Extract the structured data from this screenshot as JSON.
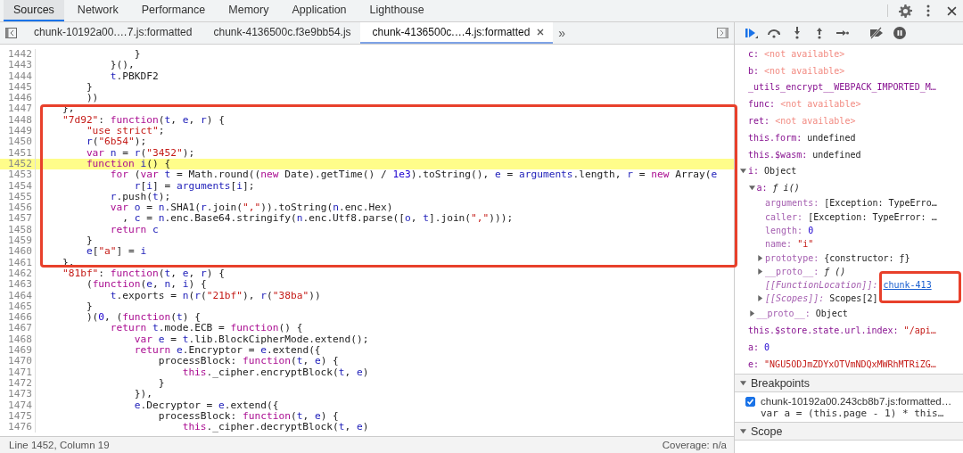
{
  "panel_tabs": [
    {
      "label": "Sources",
      "selected": true
    },
    {
      "label": "Network",
      "selected": false
    },
    {
      "label": "Performance",
      "selected": false
    },
    {
      "label": "Memory",
      "selected": false
    },
    {
      "label": "Application",
      "selected": false
    },
    {
      "label": "Lighthouse",
      "selected": false
    }
  ],
  "file_tabs": [
    {
      "label": "chunk-10192a00.…7.js:formatted",
      "selected": false
    },
    {
      "label": "chunk-4136500c.f3e9bb54.js",
      "selected": false
    },
    {
      "label": "chunk-4136500c.…4.js:formatted",
      "selected": true
    }
  ],
  "more_tabs": "»",
  "editor": {
    "lines": [
      {
        "number": "1442",
        "current": false,
        "code": [
          {
            "kind": "plain",
            "text": "                }"
          }
        ]
      },
      {
        "number": "1443",
        "current": false,
        "code": [
          {
            "kind": "plain",
            "text": "            }(),"
          }
        ]
      },
      {
        "number": "1444",
        "current": false,
        "code": [
          {
            "kind": "var",
            "text": "            t"
          },
          {
            "kind": "plain",
            "text": ".PBKDF2"
          }
        ]
      },
      {
        "number": "1445",
        "current": false,
        "code": [
          {
            "kind": "plain",
            "text": "        }"
          }
        ]
      },
      {
        "number": "1446",
        "current": false,
        "code": [
          {
            "kind": "plain",
            "text": "        ))"
          }
        ]
      },
      {
        "number": "1447",
        "current": false,
        "code": [
          {
            "kind": "plain",
            "text": "    },"
          }
        ]
      },
      {
        "number": "1448",
        "current": false,
        "code": [
          {
            "kind": "str",
            "text": "    \"7d92\""
          },
          {
            "kind": "plain",
            "text": ": "
          },
          {
            "kind": "kw",
            "text": "function"
          },
          {
            "kind": "plain",
            "text": "("
          },
          {
            "kind": "var",
            "text": "t"
          },
          {
            "kind": "plain",
            "text": ", "
          },
          {
            "kind": "var",
            "text": "e"
          },
          {
            "kind": "plain",
            "text": ", "
          },
          {
            "kind": "var",
            "text": "r"
          },
          {
            "kind": "plain",
            "text": ") {"
          }
        ]
      },
      {
        "number": "1449",
        "current": false,
        "code": [
          {
            "kind": "str",
            "text": "        \"use strict\""
          },
          {
            "kind": "plain",
            "text": ";"
          }
        ]
      },
      {
        "number": "1450",
        "current": false,
        "code": [
          {
            "kind": "var",
            "text": "        r"
          },
          {
            "kind": "plain",
            "text": "("
          },
          {
            "kind": "str",
            "text": "\"6b54\""
          },
          {
            "kind": "plain",
            "text": ");"
          }
        ]
      },
      {
        "number": "1451",
        "current": false,
        "code": [
          {
            "kind": "kw",
            "text": "        var"
          },
          {
            "kind": "var",
            "text": " n"
          },
          {
            "kind": "plain",
            "text": " = "
          },
          {
            "kind": "var",
            "text": "r"
          },
          {
            "kind": "plain",
            "text": "("
          },
          {
            "kind": "str",
            "text": "\"3452\""
          },
          {
            "kind": "plain",
            "text": ");"
          }
        ]
      },
      {
        "number": "1452",
        "current": true,
        "code": [
          {
            "kind": "kw",
            "text": "        function"
          },
          {
            "kind": "var",
            "text": " i"
          },
          {
            "kind": "plain",
            "text": "() {"
          }
        ]
      },
      {
        "number": "1453",
        "current": false,
        "code": [
          {
            "kind": "kw",
            "text": "            for"
          },
          {
            "kind": "plain",
            "text": " ("
          },
          {
            "kind": "kw",
            "text": "var"
          },
          {
            "kind": "var",
            "text": " t"
          },
          {
            "kind": "plain",
            "text": " = Math.round(("
          },
          {
            "kind": "kw",
            "text": "new"
          },
          {
            "kind": "plain",
            "text": " Date).getTime() / "
          },
          {
            "kind": "num",
            "text": "1e3"
          },
          {
            "kind": "plain",
            "text": ").toString(), "
          },
          {
            "kind": "var",
            "text": "e"
          },
          {
            "kind": "plain",
            "text": " = "
          },
          {
            "kind": "var",
            "text": "arguments"
          },
          {
            "kind": "plain",
            "text": ".length, "
          },
          {
            "kind": "var",
            "text": "r"
          },
          {
            "kind": "plain",
            "text": " = "
          },
          {
            "kind": "kw",
            "text": "new"
          },
          {
            "kind": "plain",
            "text": " Array("
          },
          {
            "kind": "var",
            "text": "e"
          }
        ]
      },
      {
        "number": "1454",
        "current": false,
        "code": [
          {
            "kind": "var",
            "text": "                r"
          },
          {
            "kind": "plain",
            "text": "["
          },
          {
            "kind": "var",
            "text": "i"
          },
          {
            "kind": "plain",
            "text": "] = "
          },
          {
            "kind": "var",
            "text": "arguments"
          },
          {
            "kind": "plain",
            "text": "["
          },
          {
            "kind": "var",
            "text": "i"
          },
          {
            "kind": "plain",
            "text": "];"
          }
        ]
      },
      {
        "number": "1455",
        "current": false,
        "code": [
          {
            "kind": "var",
            "text": "            r"
          },
          {
            "kind": "plain",
            "text": ".push("
          },
          {
            "kind": "var",
            "text": "t"
          },
          {
            "kind": "plain",
            "text": ");"
          }
        ]
      },
      {
        "number": "1456",
        "current": false,
        "code": [
          {
            "kind": "kw",
            "text": "            var"
          },
          {
            "kind": "var",
            "text": " o"
          },
          {
            "kind": "plain",
            "text": " = "
          },
          {
            "kind": "var",
            "text": "n"
          },
          {
            "kind": "plain",
            "text": ".SHA1("
          },
          {
            "kind": "var",
            "text": "r"
          },
          {
            "kind": "plain",
            "text": ".join("
          },
          {
            "kind": "str",
            "text": "\",\""
          },
          {
            "kind": "plain",
            "text": ")).toString("
          },
          {
            "kind": "var",
            "text": "n"
          },
          {
            "kind": "plain",
            "text": ".enc.Hex)"
          }
        ]
      },
      {
        "number": "1457",
        "current": false,
        "code": [
          {
            "kind": "plain",
            "text": "              , "
          },
          {
            "kind": "var",
            "text": "c"
          },
          {
            "kind": "plain",
            "text": " = "
          },
          {
            "kind": "var",
            "text": "n"
          },
          {
            "kind": "plain",
            "text": ".enc.Base64.stringify("
          },
          {
            "kind": "var",
            "text": "n"
          },
          {
            "kind": "plain",
            "text": ".enc.Utf8.parse(["
          },
          {
            "kind": "var",
            "text": "o"
          },
          {
            "kind": "plain",
            "text": ", "
          },
          {
            "kind": "var",
            "text": "t"
          },
          {
            "kind": "plain",
            "text": "].join("
          },
          {
            "kind": "str",
            "text": "\",\""
          },
          {
            "kind": "plain",
            "text": ")));"
          }
        ]
      },
      {
        "number": "1458",
        "current": false,
        "code": [
          {
            "kind": "kw",
            "text": "            return"
          },
          {
            "kind": "var",
            "text": " c"
          }
        ]
      },
      {
        "number": "1459",
        "current": false,
        "code": [
          {
            "kind": "plain",
            "text": "        }"
          }
        ]
      },
      {
        "number": "1460",
        "current": false,
        "code": [
          {
            "kind": "var",
            "text": "        e"
          },
          {
            "kind": "plain",
            "text": "["
          },
          {
            "kind": "str",
            "text": "\"a\""
          },
          {
            "kind": "plain",
            "text": "] = "
          },
          {
            "kind": "var",
            "text": "i"
          }
        ]
      },
      {
        "number": "1461",
        "current": false,
        "code": [
          {
            "kind": "plain",
            "text": "    },"
          }
        ]
      },
      {
        "number": "1462",
        "current": false,
        "code": [
          {
            "kind": "str",
            "text": "    \"81bf\""
          },
          {
            "kind": "plain",
            "text": ": "
          },
          {
            "kind": "kw",
            "text": "function"
          },
          {
            "kind": "plain",
            "text": "("
          },
          {
            "kind": "var",
            "text": "t"
          },
          {
            "kind": "plain",
            "text": ", "
          },
          {
            "kind": "var",
            "text": "e"
          },
          {
            "kind": "plain",
            "text": ", "
          },
          {
            "kind": "var",
            "text": "r"
          },
          {
            "kind": "plain",
            "text": ") {"
          }
        ]
      },
      {
        "number": "1463",
        "current": false,
        "code": [
          {
            "kind": "plain",
            "text": "        ("
          },
          {
            "kind": "kw",
            "text": "function"
          },
          {
            "kind": "plain",
            "text": "("
          },
          {
            "kind": "var",
            "text": "e"
          },
          {
            "kind": "plain",
            "text": ", "
          },
          {
            "kind": "var",
            "text": "n"
          },
          {
            "kind": "plain",
            "text": ", "
          },
          {
            "kind": "var",
            "text": "i"
          },
          {
            "kind": "plain",
            "text": ") {"
          }
        ]
      },
      {
        "number": "1464",
        "current": false,
        "code": [
          {
            "kind": "var",
            "text": "            t"
          },
          {
            "kind": "plain",
            "text": ".exports = "
          },
          {
            "kind": "var",
            "text": "n"
          },
          {
            "kind": "plain",
            "text": "("
          },
          {
            "kind": "var",
            "text": "r"
          },
          {
            "kind": "plain",
            "text": "("
          },
          {
            "kind": "str",
            "text": "\"21bf\""
          },
          {
            "kind": "plain",
            "text": "), "
          },
          {
            "kind": "var",
            "text": "r"
          },
          {
            "kind": "plain",
            "text": "("
          },
          {
            "kind": "str",
            "text": "\"38ba\""
          },
          {
            "kind": "plain",
            "text": "))"
          }
        ]
      },
      {
        "number": "1465",
        "current": false,
        "code": [
          {
            "kind": "plain",
            "text": "        }"
          }
        ]
      },
      {
        "number": "1466",
        "current": false,
        "code": [
          {
            "kind": "plain",
            "text": "        )("
          },
          {
            "kind": "num",
            "text": "0"
          },
          {
            "kind": "plain",
            "text": ", ("
          },
          {
            "kind": "kw",
            "text": "function"
          },
          {
            "kind": "plain",
            "text": "("
          },
          {
            "kind": "var",
            "text": "t"
          },
          {
            "kind": "plain",
            "text": ") {"
          }
        ]
      },
      {
        "number": "1467",
        "current": false,
        "code": [
          {
            "kind": "kw",
            "text": "            return"
          },
          {
            "kind": "var",
            "text": " t"
          },
          {
            "kind": "plain",
            "text": ".mode.ECB = "
          },
          {
            "kind": "kw",
            "text": "function"
          },
          {
            "kind": "plain",
            "text": "() {"
          }
        ]
      },
      {
        "number": "1468",
        "current": false,
        "code": [
          {
            "kind": "kw",
            "text": "                var"
          },
          {
            "kind": "var",
            "text": " e"
          },
          {
            "kind": "plain",
            "text": " = "
          },
          {
            "kind": "var",
            "text": "t"
          },
          {
            "kind": "plain",
            "text": ".lib.BlockCipherMode.extend();"
          }
        ]
      },
      {
        "number": "1469",
        "current": false,
        "code": [
          {
            "kind": "kw",
            "text": "                return"
          },
          {
            "kind": "var",
            "text": " e"
          },
          {
            "kind": "plain",
            "text": ".Encryptor = "
          },
          {
            "kind": "var",
            "text": "e"
          },
          {
            "kind": "plain",
            "text": ".extend({"
          }
        ]
      },
      {
        "number": "1470",
        "current": false,
        "code": [
          {
            "kind": "plain",
            "text": "                    processBlock: "
          },
          {
            "kind": "kw",
            "text": "function"
          },
          {
            "kind": "plain",
            "text": "("
          },
          {
            "kind": "var",
            "text": "t"
          },
          {
            "kind": "plain",
            "text": ", "
          },
          {
            "kind": "var",
            "text": "e"
          },
          {
            "kind": "plain",
            "text": ") {"
          }
        ]
      },
      {
        "number": "1471",
        "current": false,
        "code": [
          {
            "kind": "kw",
            "text": "                        this"
          },
          {
            "kind": "plain",
            "text": "._cipher.encryptBlock("
          },
          {
            "kind": "var",
            "text": "t"
          },
          {
            "kind": "plain",
            "text": ", "
          },
          {
            "kind": "var",
            "text": "e"
          },
          {
            "kind": "plain",
            "text": ")"
          }
        ]
      },
      {
        "number": "1472",
        "current": false,
        "code": [
          {
            "kind": "plain",
            "text": "                    }"
          }
        ]
      },
      {
        "number": "1473",
        "current": false,
        "code": [
          {
            "kind": "plain",
            "text": "                }),"
          }
        ]
      },
      {
        "number": "1474",
        "current": false,
        "code": [
          {
            "kind": "var",
            "text": "                e"
          },
          {
            "kind": "plain",
            "text": ".Decryptor = "
          },
          {
            "kind": "var",
            "text": "e"
          },
          {
            "kind": "plain",
            "text": ".extend({"
          }
        ]
      },
      {
        "number": "1475",
        "current": false,
        "code": [
          {
            "kind": "plain",
            "text": "                    processBlock: "
          },
          {
            "kind": "kw",
            "text": "function"
          },
          {
            "kind": "plain",
            "text": "("
          },
          {
            "kind": "var",
            "text": "t"
          },
          {
            "kind": "plain",
            "text": ", "
          },
          {
            "kind": "var",
            "text": "e"
          },
          {
            "kind": "plain",
            "text": ") {"
          }
        ]
      },
      {
        "number": "1476",
        "current": false,
        "code": [
          {
            "kind": "kw",
            "text": "                        this"
          },
          {
            "kind": "plain",
            "text": "._cipher.decryptBlock("
          },
          {
            "kind": "var",
            "text": "t"
          },
          {
            "kind": "plain",
            "text": ", "
          },
          {
            "kind": "var",
            "text": "e"
          },
          {
            "kind": "plain",
            "text": ")"
          }
        ]
      }
    ]
  },
  "status_bar": {
    "position": "Line 1452, Column 19",
    "coverage": "Coverage: n/a"
  },
  "scope_items": [
    {
      "key": {
        "kind": "normal",
        "text": "c:"
      },
      "value": {
        "kind": "unavailable",
        "text": "<not available>"
      }
    },
    {
      "key": {
        "kind": "normal",
        "text": "b:"
      },
      "value": {
        "kind": "unavailable",
        "text": "<not available>"
      }
    },
    {
      "key": {
        "kind": "normal",
        "text": "_utils_encrypt__WEBPACK_IMPORTED_M…"
      }
    },
    {
      "key": {
        "kind": "normal",
        "text": "func:"
      },
      "value": {
        "kind": "unavailable",
        "text": "<not available>"
      }
    },
    {
      "key": {
        "kind": "normal",
        "text": "ret:"
      },
      "value": {
        "kind": "unavailable",
        "text": "<not available>"
      }
    },
    {
      "key": {
        "kind": "normal",
        "text": "this.form:"
      },
      "value": {
        "kind": "plain",
        "text": "undefined"
      }
    },
    {
      "key": {
        "kind": "normal",
        "text": "this.$wasm:"
      },
      "value": {
        "kind": "plain",
        "text": "undefined"
      }
    },
    {
      "key": {
        "kind": "normal",
        "text": "i:"
      },
      "value": {
        "kind": "plain",
        "text": "Object"
      },
      "expanded": true,
      "children": [
        {
          "key": {
            "kind": "normal",
            "text": "a:"
          },
          "value": {
            "kind": "function",
            "text": "ƒ i()"
          },
          "expanded": true,
          "children": [
            {
              "key": {
                "kind": "dim",
                "text": "arguments:"
              },
              "value": {
                "kind": "plain",
                "text": "[Exception: TypeErro…"
              }
            },
            {
              "key": {
                "kind": "dim",
                "text": "caller:"
              },
              "value": {
                "kind": "plain",
                "text": "[Exception: TypeError: …"
              }
            },
            {
              "key": {
                "kind": "dim",
                "text": "length:"
              },
              "value": {
                "kind": "number",
                "text": "0"
              }
            },
            {
              "key": {
                "kind": "dim",
                "text": "name:"
              },
              "value": {
                "kind": "string",
                "text": "\"i\""
              }
            },
            {
              "key": {
                "kind": "dim",
                "text": "prototype:"
              },
              "value": {
                "kind": "plain",
                "text": "{constructor: ƒ}"
              },
              "expanded": false
            },
            {
              "key": {
                "kind": "dim",
                "text": "__proto__:"
              },
              "value": {
                "kind": "function",
                "text": "ƒ ()"
              },
              "expanded": false
            },
            {
              "key": {
                "kind": "internal",
                "text": "[[FunctionLocation]]:"
              },
              "value": {
                "kind": "link",
                "text": "chunk-413"
              }
            },
            {
              "key": {
                "kind": "internal",
                "text": "[[Scopes]]:"
              },
              "value": {
                "kind": "plain",
                "text": "Scopes[2]"
              },
              "expanded": false
            }
          ]
        },
        {
          "key": {
            "kind": "dim",
            "text": "__proto__:"
          },
          "value": {
            "kind": "plain",
            "text": "Object"
          },
          "expanded": false
        }
      ]
    },
    {
      "key": {
        "kind": "normal",
        "text": "this.$store.state.url.index:"
      },
      "value": {
        "kind": "string",
        "text": "\"/api…"
      }
    },
    {
      "key": {
        "kind": "normal",
        "text": "a:"
      },
      "value": {
        "kind": "number",
        "text": "0"
      }
    },
    {
      "key": {
        "kind": "normal",
        "text": "e:"
      },
      "value": {
        "kind": "string",
        "text": "\"NGU5ODJmZDYxOTVmNDQxMWRhMTRiZG…"
      }
    }
  ],
  "breakpoints": {
    "title": "Breakpoints",
    "expanded": true,
    "items": [
      {
        "file": "chunk-10192a00.243cb8b7.js:formatted…",
        "code": "var a = (this.page - 1) * this…",
        "checked": true
      }
    ]
  },
  "scope_section": {
    "title": "Scope",
    "expanded": true
  }
}
